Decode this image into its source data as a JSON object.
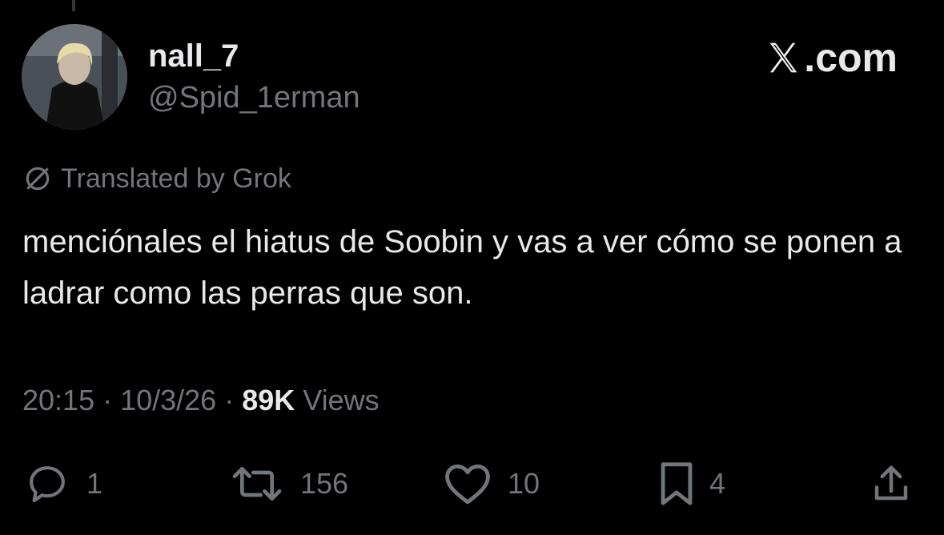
{
  "author": {
    "display_name": "nall_7",
    "handle": "@Spid_1erman",
    "avatar": "avatar-image"
  },
  "brand": {
    "label": ".com",
    "icon": "x-logo-icon"
  },
  "translation": {
    "label": "Translated by Grok",
    "icon": "translate-icon"
  },
  "tweet": {
    "text": "menciónales el hiatus de Soobin y vas a ver cómo se ponen a ladrar como las perras que son."
  },
  "meta": {
    "time": "20:15",
    "sep1": " · ",
    "date": "10/3/26",
    "sep2": " · ",
    "views_count": "89K",
    "views_label": " Views"
  },
  "actions": {
    "replies": "1",
    "reposts": "156",
    "likes": "10",
    "bookmarks": "4"
  },
  "colors": {
    "background": "#000000",
    "primary_text": "#e7e9ea",
    "secondary_text": "#71767b"
  }
}
